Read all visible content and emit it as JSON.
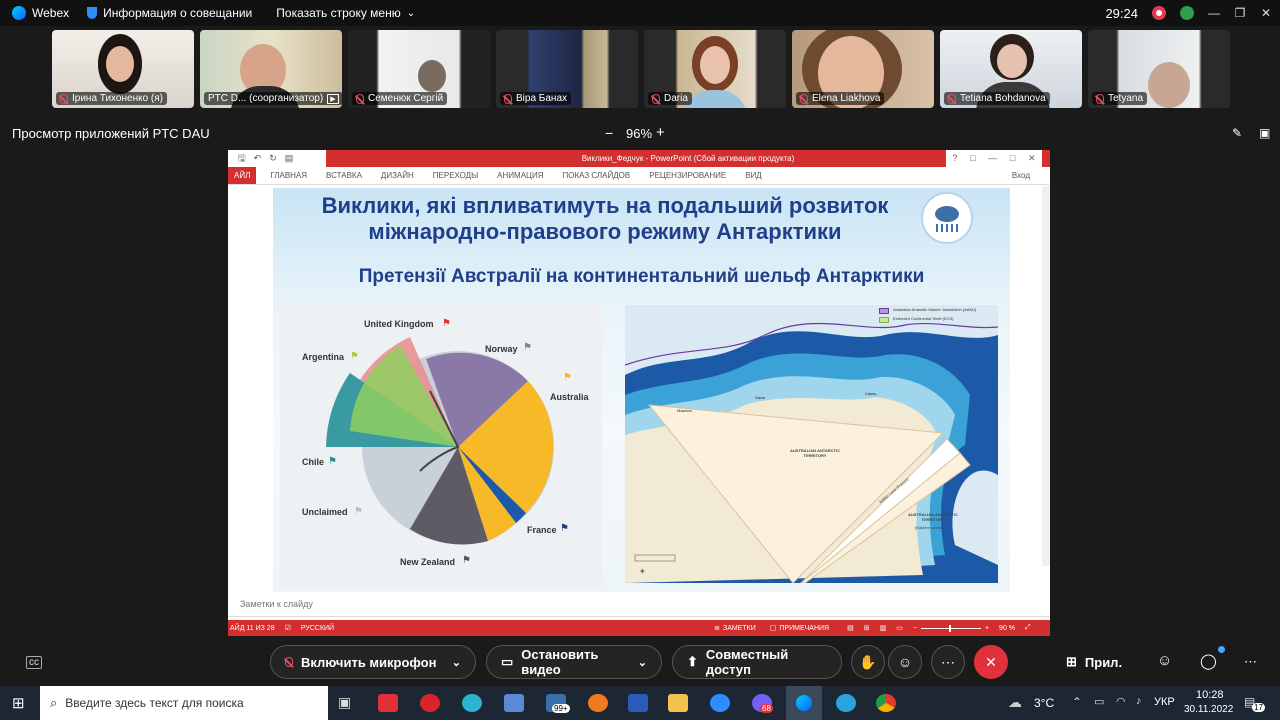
{
  "topbar": {
    "app_name": "Webex",
    "meeting_info": "Информация о совещании",
    "show_menu": "Показать строку меню",
    "timer": "29:24"
  },
  "participants": [
    {
      "name": "Ірина Тихоненко (я)"
    },
    {
      "name": "PTC D... (соорганизатор)"
    },
    {
      "name": "Семенюк Сергій"
    },
    {
      "name": "Віра Банах"
    },
    {
      "name": "Daria"
    },
    {
      "name": "Elena Liakhova"
    },
    {
      "name": "Tetiana Bohdanova"
    },
    {
      "name": "Tetyana"
    }
  ],
  "share": {
    "title": "Просмотр приложений PTC DAU",
    "zoom_minus": "−",
    "zoom": "96%",
    "zoom_plus": "+"
  },
  "ppt": {
    "window_title": "Виклики_Федчук - PowerPoint (Сбой активации продукта)",
    "signin": "Вход",
    "tabs": [
      "АЙЛ",
      "ГЛАВНАЯ",
      "ВСТАВКА",
      "ДИЗАЙН",
      "ПЕРЕХОДЫ",
      "АНИМАЦИЯ",
      "ПОКАЗ СЛАЙДОВ",
      "РЕЦЕНЗИРОВАНИЕ",
      "ВИД"
    ],
    "notes_placeholder": "Заметки к слайду",
    "status": {
      "slide": "АЙД 11 ИЗ 28",
      "lang": "РУССКИЙ",
      "notes": "ЗАМЕТКИ",
      "comments": "ПРИМЕЧАНИЯ",
      "zoom": "90 %"
    }
  },
  "slide": {
    "title_line1": "Виклики, які впливатимуть на подальший розвиток",
    "title_line2": "міжнародно-правового режиму Антарктики",
    "subtitle": "Претензії Австралії на континентальний шельф Антарктики",
    "pie_labels": {
      "uk": "United Kingdom",
      "argentina": "Argentina",
      "norway": "Norway",
      "australia": "Australia",
      "chile": "Chile",
      "unclaimed": "Unclaimed",
      "france": "France",
      "nz": "New Zealand"
    },
    "map": {
      "legend1": "Australian Antarctic Marine Jurisdiction (AAMJ)",
      "legend2": "Extended Continental Shelf (ECS)",
      "territory1": "AUSTRALIAN ANTARCTIC TERRITORY",
      "territory2": "AUSTRALIAN ANTARCTIC TERRITORY",
      "territory2_sub": "(Eastern sector)",
      "adelie": "Adélie Land (France)",
      "mawson": "Mawson",
      "davis": "Davis",
      "casey": "Casey"
    }
  },
  "controls": {
    "mic": "Включить микрофон",
    "video": "Остановить видео",
    "share": "Совместный доступ",
    "apps": "Прил."
  },
  "taskbar": {
    "search_placeholder": "Введите здесь текст для поиска",
    "weather": "3°C",
    "lang": "УКР",
    "time": "10:28",
    "date": "30.11.2022",
    "badge_99": "99+",
    "badge_68": "68",
    "notif": "17"
  }
}
